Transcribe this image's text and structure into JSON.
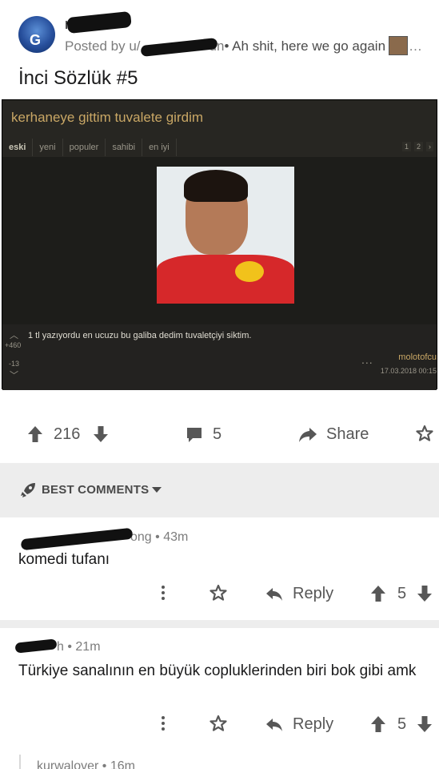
{
  "post": {
    "subreddit": "r/",
    "posted_by": "Posted by u/",
    "posted_suffix": "un",
    "flair_text": "• Ah shit, here we go again",
    "more": "…",
    "title": "İnci Sözlük #5"
  },
  "embed": {
    "title": "kerhaneye gittim tuvalete girdim",
    "tabs": [
      "eski",
      "yeni",
      "populer",
      "sahibi",
      "en iyi"
    ],
    "pages": [
      "1",
      "2",
      "›"
    ],
    "entry_text": "1 tl yazıyordu en ucuzu bu galiba dedim tuvaletçiyi siktim.",
    "score_up": "+460",
    "score_down": "-13",
    "dots": "...",
    "author": "molotofcu",
    "date": "17.03.2018 00:15"
  },
  "actions": {
    "upvotes": "216",
    "comments": "5",
    "share": "Share"
  },
  "best_comments": {
    "label": "BEST COMMENTS"
  },
  "comments": [
    {
      "meta": "ong • 43m",
      "body": "komedi tufanı",
      "reply": "Reply",
      "score": "5"
    },
    {
      "meta": "h • 21m",
      "body": "Türkiye sanalının en büyük copluklerinden biri bok gibi amk",
      "reply": "Reply",
      "score": "5"
    },
    {
      "meta": "kurwalover • 16m"
    }
  ],
  "colors": {
    "accent_embed": "#c9a765",
    "icon_gray": "#575757",
    "background_bar": "#ededed"
  }
}
